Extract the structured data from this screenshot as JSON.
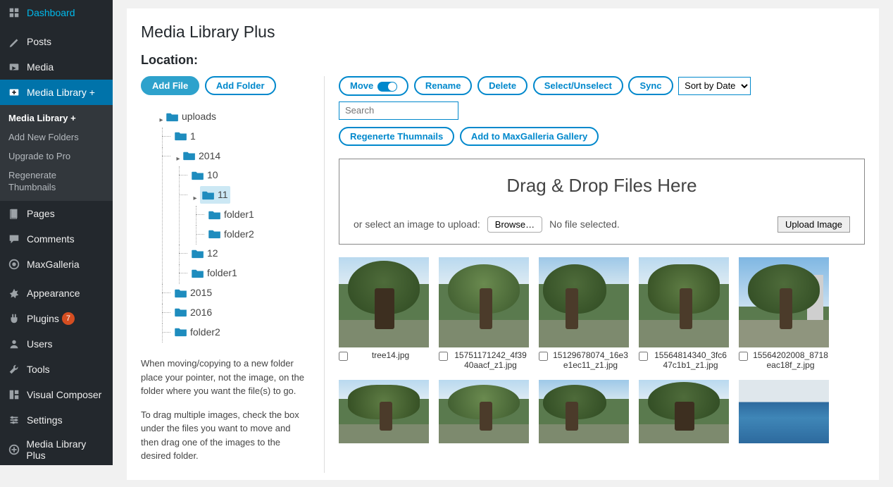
{
  "sidebar": {
    "items": [
      {
        "name": "dashboard",
        "label": "Dashboard"
      },
      {
        "name": "posts",
        "label": "Posts"
      },
      {
        "name": "media",
        "label": "Media"
      },
      {
        "name": "media-library-plus",
        "label": "Media Library +",
        "active": true
      },
      {
        "name": "pages",
        "label": "Pages"
      },
      {
        "name": "comments",
        "label": "Comments"
      },
      {
        "name": "maxgalleria",
        "label": "MaxGalleria"
      },
      {
        "name": "appearance",
        "label": "Appearance"
      },
      {
        "name": "plugins",
        "label": "Plugins",
        "badge": "7"
      },
      {
        "name": "users",
        "label": "Users"
      },
      {
        "name": "tools",
        "label": "Tools"
      },
      {
        "name": "visual-composer",
        "label": "Visual Composer"
      },
      {
        "name": "settings",
        "label": "Settings"
      },
      {
        "name": "media-library-plus-2",
        "label": "Media Library Plus"
      }
    ],
    "sub": [
      {
        "label": "Media Library +",
        "active": true
      },
      {
        "label": "Add New Folders"
      },
      {
        "label": "Upgrade to Pro"
      },
      {
        "label": "Regenerate Thumbnails"
      }
    ]
  },
  "page": {
    "title": "Media Library Plus",
    "location_label": "Location:"
  },
  "left_buttons": {
    "add_file": "Add File",
    "add_folder": "Add Folder"
  },
  "toolbar": {
    "move": "Move",
    "rename": "Rename",
    "delete": "Delete",
    "select": "Select/Unselect",
    "sync": "Sync",
    "sort_placeholder": "Sort by Date",
    "search_placeholder": "Search",
    "regen": "Regenerte Thumnails",
    "add_gallery": "Add to MaxGalleria Gallery"
  },
  "tree": [
    {
      "label": "uploads",
      "exp": "▸",
      "children": [
        {
          "label": "1"
        },
        {
          "label": "2014",
          "exp": "▸",
          "children": [
            {
              "label": "10"
            },
            {
              "label": "11",
              "exp": "▸",
              "selected": true,
              "children": [
                {
                  "label": "folder1"
                },
                {
                  "label": "folder2"
                }
              ]
            },
            {
              "label": "12"
            },
            {
              "label": "folder1"
            }
          ]
        },
        {
          "label": "2015"
        },
        {
          "label": "2016"
        },
        {
          "label": "folder2"
        }
      ]
    }
  ],
  "help": {
    "p1": "When moving/copying to a new folder place your pointer, not the image, on the folder where you want the file(s) to go.",
    "p2": "To drag multiple images, check the box under the files you want to move and then drag one of the images to the desired folder."
  },
  "dropzone": {
    "title": "Drag & Drop Files Here",
    "or_text": "or select an image to upload:",
    "browse": "Browse…",
    "no_file": "No file selected.",
    "upload": "Upload Image"
  },
  "files": [
    {
      "name": "tree14.jpg",
      "v": "variant-4"
    },
    {
      "name": "15751171242_4f3940aacf_z1.jpg",
      "v": "variant-1"
    },
    {
      "name": "15129678074_16e3e1ec11_z1.jpg",
      "v": "variant-2"
    },
    {
      "name": "15564814340_3fc647c1b1_z1.jpg",
      "v": "variant-3"
    },
    {
      "name": "15564202008_8718eac18f_z.jpg",
      "v": "variant-5"
    }
  ],
  "files_row2": [
    {
      "v": "variant-3"
    },
    {
      "v": "variant-1"
    },
    {
      "v": "variant-2"
    },
    {
      "v": "variant-4"
    },
    {
      "v": "variant-mural"
    }
  ]
}
